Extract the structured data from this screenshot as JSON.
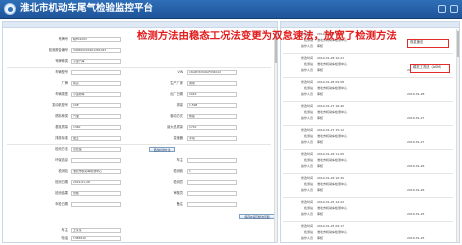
{
  "app": {
    "title": "淮北市机动车尾气检验监控平台"
  },
  "annotation": "检测方法由稳态工况法变更为双怠速法，放宽了检测方法",
  "left_panel": {
    "header": "",
    "form": [
      {
        "label": "号牌号",
        "value": "皖F04203"
      },
      {
        "label": "检测报告编号",
        "value": "340600201901281043"
      },
      {
        "label": "号牌种类",
        "value": "小型汽车"
      },
      {
        "label": "车辆型号",
        "value": "",
        "right_label": "VIN",
        "right_value": "LSGPC52U6GF034012"
      },
      {
        "label": "厂牌",
        "value": "别克",
        "right_label": "生产厂家",
        "right_value": "通用"
      },
      {
        "label": "车辆类型",
        "value": "小型轿车",
        "right_label": "出厂日期",
        "right_value": "2016"
      },
      {
        "label": "发动机型号",
        "value": "LDE",
        "right_label": "排量",
        "right_value": "1.598"
      },
      {
        "label": "燃料种类",
        "value": "汽油",
        "right_label": "驱动方式",
        "right_value": "前驱"
      },
      {
        "label": "基准质量",
        "value": "1360",
        "right_label": "最大总质量",
        "right_value": "1710"
      },
      {
        "label": "排放标准",
        "value": "国五",
        "right_label": "变速器",
        "right_value": "手动"
      },
      {
        "label": "检测方法",
        "value": "双怠速",
        "button": "更改检测方法"
      },
      {
        "label": "环保信息",
        "value": "",
        "right_label": "车主",
        "right_value": ""
      },
      {
        "label": "检测站",
        "value": "淮北市机动车检测中心",
        "right_label": "检测线",
        "right_value": "1"
      },
      {
        "label": "检测日期",
        "value": "2019-01-28",
        "right_label": "检测员",
        "right_value": ""
      },
      {
        "label": "检测结果",
        "value": "合格",
        "right_label": "审核员",
        "right_value": ""
      },
      {
        "label": "年检日期",
        "value": "",
        "right_label": "备注",
        "right_value": ""
      }
    ],
    "bottom_button": "保存并返回修改页面",
    "footer_fields": [
      {
        "label": "车主",
        "value": "王某某"
      },
      {
        "label": "电话",
        "value": "1385610"
      }
    ]
  },
  "right_panel": {
    "highlight_top": {
      "label": "检测方法",
      "value": "双怠速法"
    },
    "highlight_mid": {
      "label": "检测方法",
      "value": "稳态工况法（ASM）"
    },
    "records": [
      {
        "label1": "修改时间",
        "value1": "2019-01-28 10:43",
        "label2": "检测站",
        "value2": "淮北市机动车检测中心",
        "label3": "操作人员",
        "value3": "审核",
        "right": "2019-01-28"
      },
      {
        "label1": "修改时间",
        "value1": "2019-01-28 10:21",
        "label2": "检测站",
        "value2": "淮北市机动车检测中心",
        "label3": "操作人员",
        "value3": "审核",
        "right": "2019-01-28"
      },
      {
        "label1": "修改时间",
        "value1": "2019-01-28 09:58",
        "label2": "检测站",
        "value2": "淮北市机动车检测中心",
        "label3": "操作人员",
        "value3": "审核",
        "right": "2019-01-28"
      },
      {
        "label1": "修改时间",
        "value1": "2019-01-27 16:40",
        "label2": "检测站",
        "value2": "淮北市机动车检测中心",
        "label3": "操作人员",
        "value3": "审核",
        "right": "2019-01-27"
      },
      {
        "label1": "修改时间",
        "value1": "2019-01-27 15:12",
        "label2": "检测站",
        "value2": "淮北市机动车检测中心",
        "label3": "操作人员",
        "value3": "审核",
        "right": "2019-01-27"
      },
      {
        "label1": "修改时间",
        "value1": "2019-01-26 11:05",
        "label2": "检测站",
        "value2": "淮北市机动车检测中心",
        "label3": "操作人员",
        "value3": "审核",
        "right": "2019-01-26"
      },
      {
        "label1": "修改时间",
        "value1": "2019-01-26 10:30",
        "label2": "检测站",
        "value2": "淮北市机动车检测中心",
        "label3": "操作人员",
        "value3": "审核",
        "right": "2019-01-26"
      },
      {
        "label1": "修改时间",
        "value1": "2019-01-25 14:22",
        "label2": "检测站",
        "value2": "淮北市机动车检测中心",
        "label3": "操作人员",
        "value3": "审核",
        "right": "2019-01-25"
      },
      {
        "label1": "修改时间",
        "value1": "2019-01-25 09:17",
        "label2": "检测站",
        "value2": "淮北市机动车检测中心",
        "label3": "操作人员",
        "value3": "审核",
        "right": "2019-01-25"
      }
    ]
  },
  "colors": {
    "header": "#2e6fb8",
    "annotation": "#e31c1c",
    "highlight_border": "#e52a2a"
  },
  "icons": [
    "app-logo-icon",
    "window-minimize-icon",
    "window-close-icon"
  ]
}
